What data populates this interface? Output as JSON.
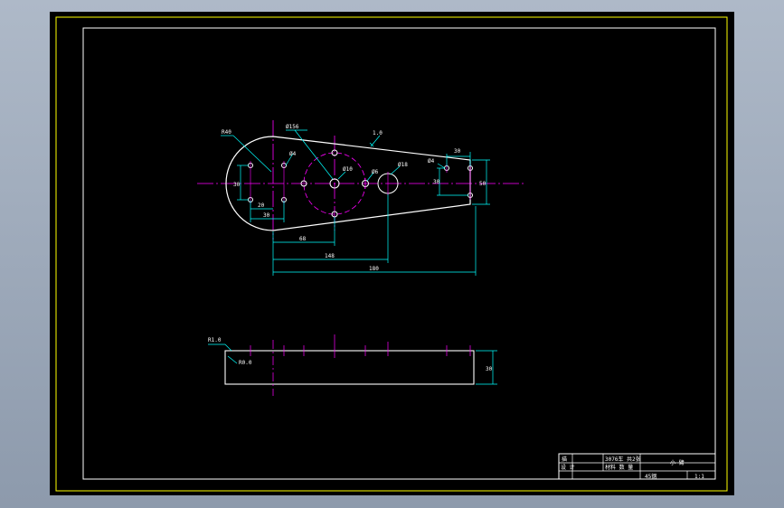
{
  "colors": {
    "background": "#000000",
    "frame": "#ffff00",
    "border": "#ffffff",
    "outline": "#ffffff",
    "centerline": "#ff00ff",
    "dimension": "#00ffff",
    "hidden": "#ff00ff"
  },
  "plan_view": {
    "dimensions": {
      "r_left": "R40",
      "d_pitch": "Ø156",
      "d_small_left": "Ø4",
      "angle": "1.0",
      "d_right_hole": "Ø18",
      "d_center": "Ø10",
      "d_mid": "Ø6",
      "d_right_small": "Ø4",
      "w_right_top": "30",
      "h_right_inner": "30",
      "h_right_outer": "50",
      "h_left": "30",
      "x_left_small": "20",
      "x_left_bottom": "30",
      "x_center": "68",
      "x_mid": "148",
      "x_total": "180"
    }
  },
  "side_view": {
    "dimensions": {
      "chamfer_top": "R1.0",
      "chamfer_side": "R0.0",
      "thickness": "30"
    }
  },
  "title_block": {
    "row1_col1": "描",
    "row1_col2": "3076车 共2张",
    "row2_col1": "设 计",
    "row2_col2": "材料 数 量",
    "part_name": "小 臂",
    "material": "45钢",
    "scale": "1:1"
  }
}
